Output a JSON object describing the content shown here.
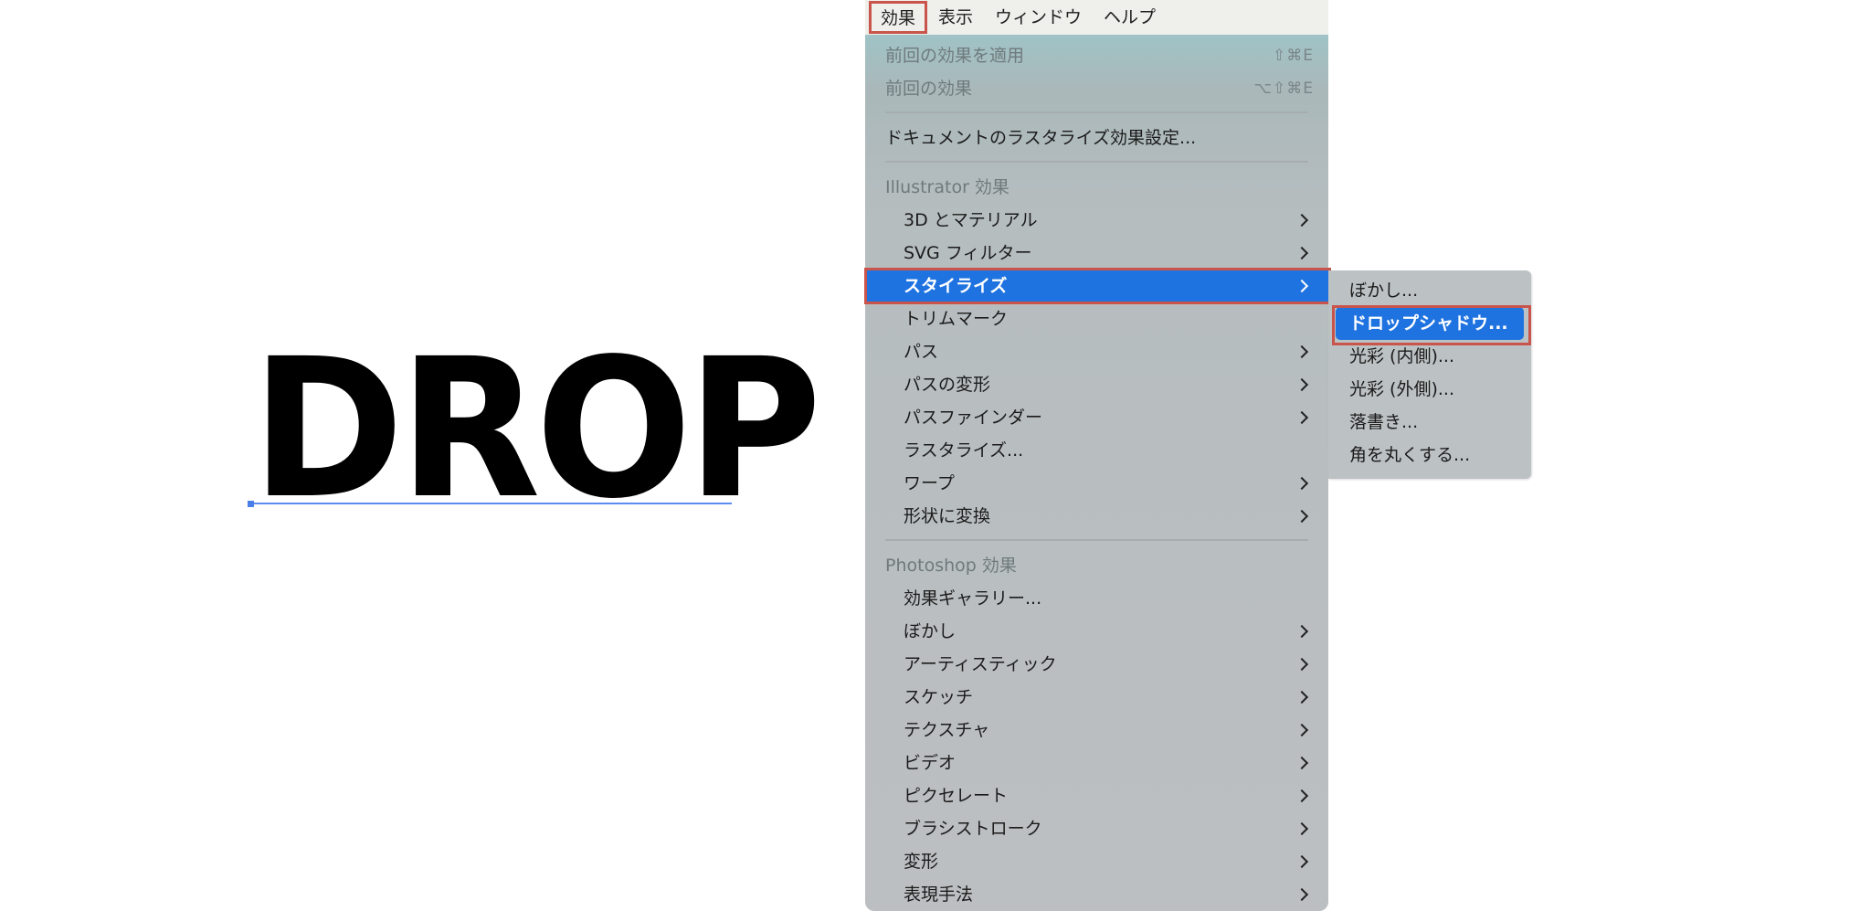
{
  "canvas": {
    "artwork_text": "DROP"
  },
  "menubar": {
    "items": [
      "効果",
      "表示",
      "ウィンドウ",
      "ヘルプ"
    ]
  },
  "menu": {
    "apply_last": {
      "label": "前回の効果を適用",
      "shortcut": "⇧⌘E"
    },
    "last_effect": {
      "label": "前回の効果",
      "shortcut": "⌥⇧⌘E"
    },
    "doc_raster": "ドキュメントのラスタライズ効果設定...",
    "illustrator_header": "Illustrator 効果",
    "illustrator_items": [
      "3D とマテリアル",
      "SVG フィルター",
      "スタイライズ",
      "トリムマーク",
      "パス",
      "パスの変形",
      "パスファインダー",
      "ラスタライズ...",
      "ワープ",
      "形状に変換"
    ],
    "photoshop_header": "Photoshop 効果",
    "photoshop_items": [
      "効果ギャラリー...",
      "ぼかし",
      "アーティスティック",
      "スケッチ",
      "テクスチャ",
      "ビデオ",
      "ピクセレート",
      "ブラシストローク",
      "変形",
      "表現手法"
    ]
  },
  "submenu": {
    "items": [
      "ぼかし...",
      "ドロップシャドウ...",
      "光彩 (内側)...",
      "光彩 (外側)...",
      "落書き...",
      "角を丸くする..."
    ]
  },
  "colors": {
    "highlight": "#1f73e0",
    "annotation_frame": "#c9544b"
  }
}
